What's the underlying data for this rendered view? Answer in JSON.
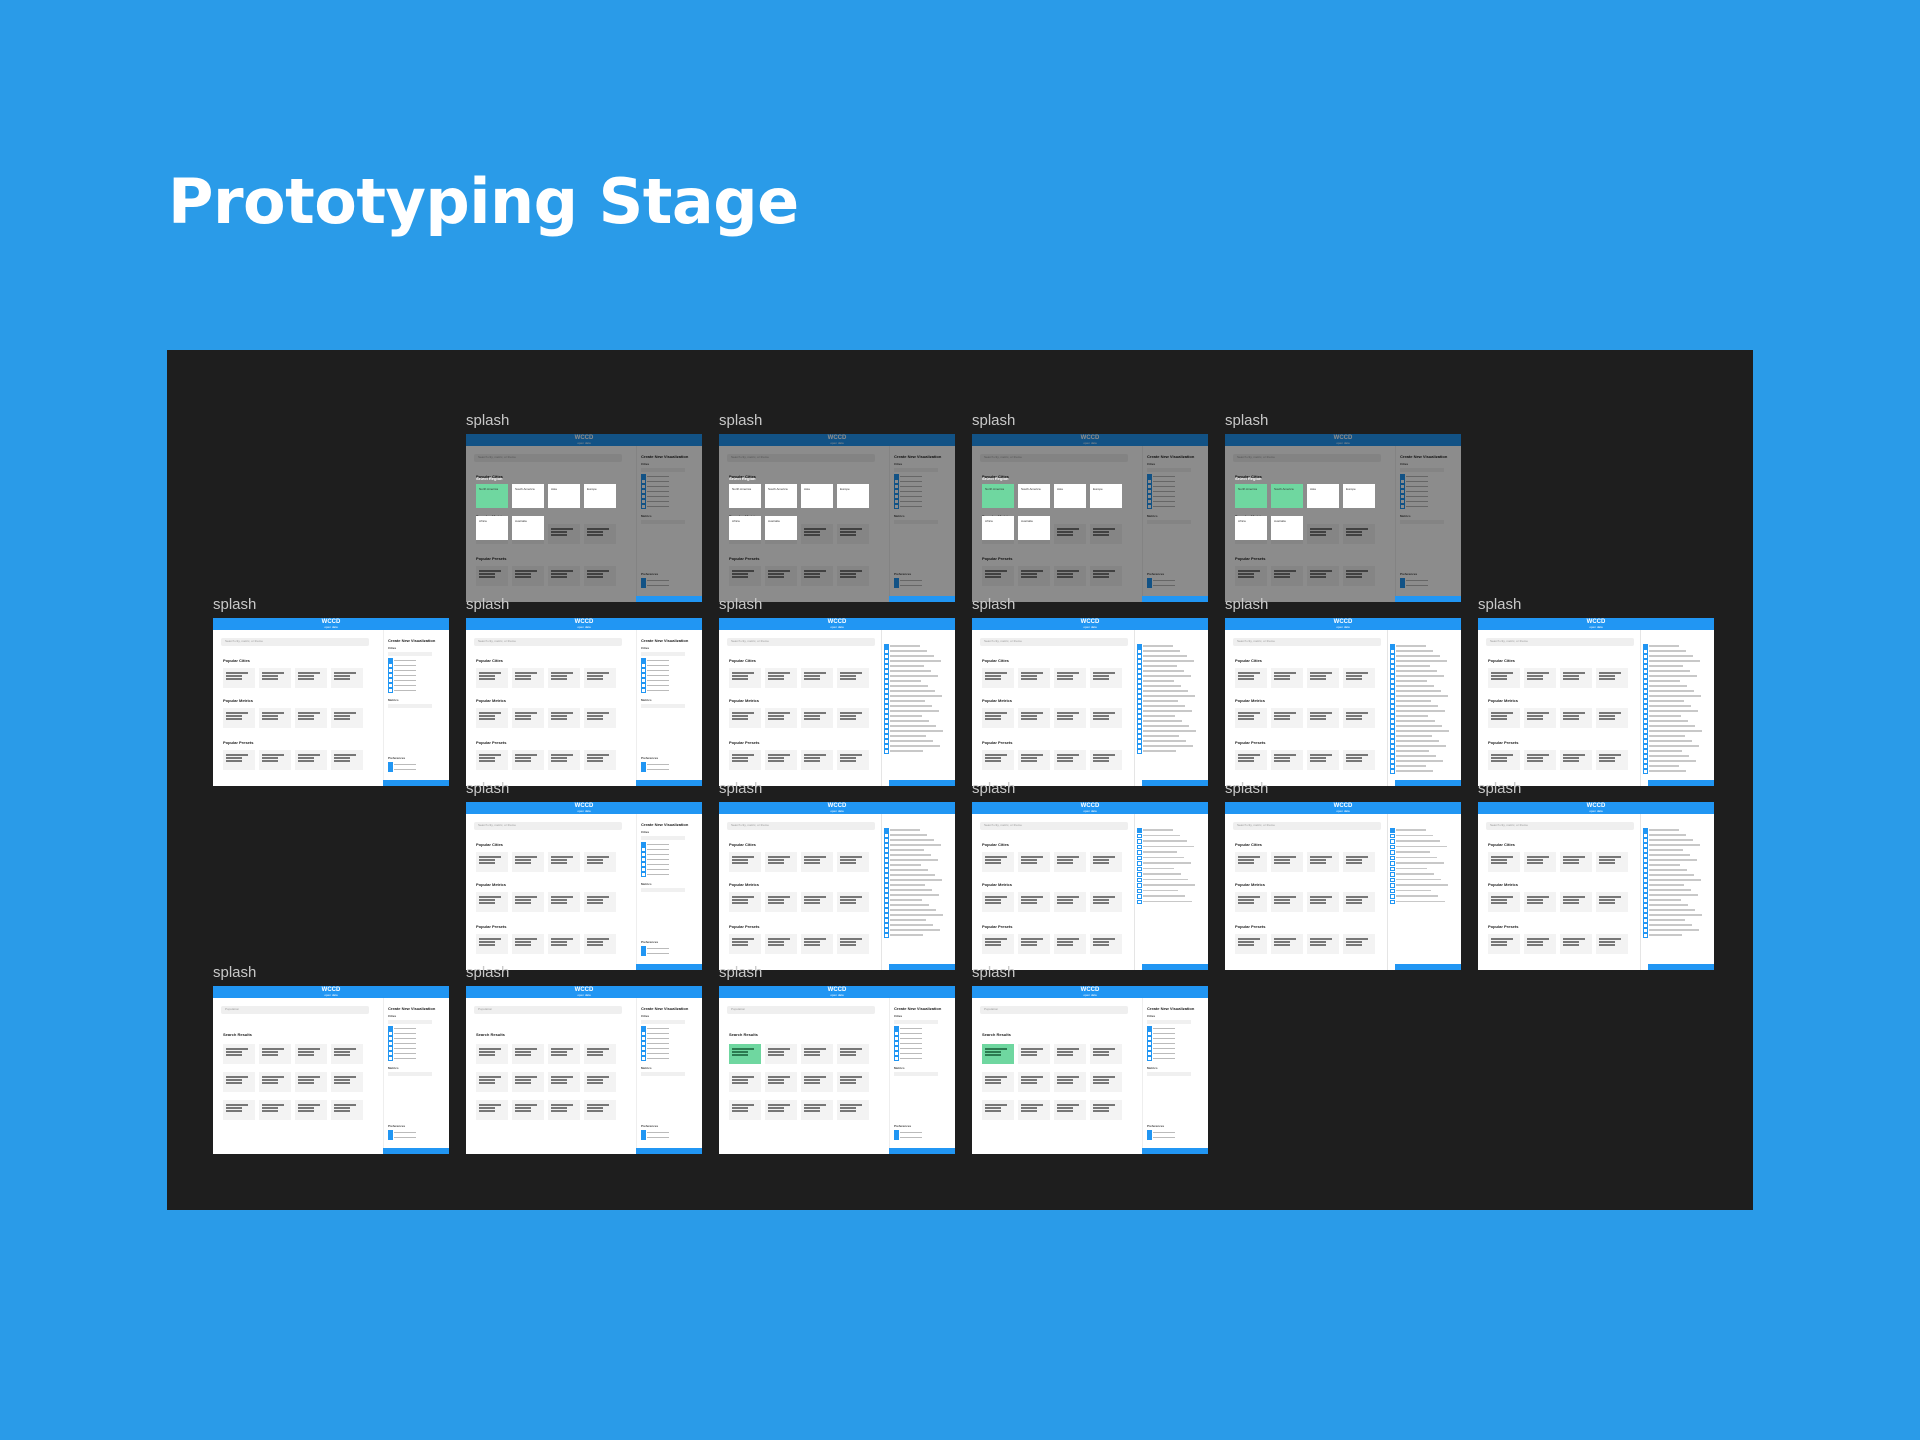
{
  "page": {
    "title": "Prototyping Stage"
  },
  "frame_label": "splash",
  "mockup": {
    "logo": "WCCD",
    "logo_sub": "open data",
    "search_placeholder": "Search city, metric, or theme",
    "search_query": "Population",
    "sidebar_title": "Create New Visualization",
    "sidebar_cities": "Cities",
    "sidebar_metrics": "Metrics",
    "sidebar_preferences": "Preferences",
    "sec_popular_cities": "Popular Cities",
    "sec_popular_metrics": "Popular Metrics",
    "sec_popular_presets": "Popular Presets",
    "sec_search_results": "Search Results",
    "select_region": "Select Region",
    "regions": [
      "North America",
      "South America",
      "Asia",
      "Europe",
      "Africa",
      "Australia"
    ]
  },
  "colors": {
    "background": "#2a9be8",
    "canvas": "#1e1e1e",
    "accent": "#2196f3",
    "highlight": "#6fd7a0"
  }
}
